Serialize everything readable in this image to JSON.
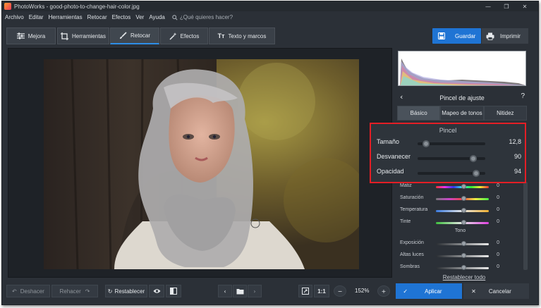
{
  "window": {
    "title": "PhotoWorks - good-photo-to-change-hair-color.jpg",
    "controls": [
      "—",
      "❐",
      "✕"
    ]
  },
  "menu": {
    "items": [
      "Archivo",
      "Editar",
      "Herramientas",
      "Retocar",
      "Efectos",
      "Ver",
      "Ayuda"
    ],
    "search_placeholder": "¿Qué quieres hacer?"
  },
  "tabs": [
    {
      "label": "Mejora",
      "icon": "sliders-icon"
    },
    {
      "label": "Herramientas",
      "icon": "crop-icon"
    },
    {
      "label": "Retocar",
      "icon": "brush-icon",
      "active": true
    },
    {
      "label": "Efectos",
      "icon": "magic-wand-icon"
    },
    {
      "label": "Texto y marcos",
      "icon": "text-icon"
    }
  ],
  "actions": {
    "save_label": "Guardar",
    "print_label": "Imprimir"
  },
  "panel": {
    "title": "Pincel de ajuste",
    "back_icon": "chevron-left-icon",
    "help_label": "?",
    "subtabs": [
      "Básico",
      "Mapeo de tonos",
      "Nitidez"
    ],
    "active_subtab": "Básico"
  },
  "brush": {
    "section_title": "Pincel",
    "sliders": [
      {
        "label": "Tamaño",
        "value": "12,8",
        "level": 0.12
      },
      {
        "label": "Desvanecer",
        "value": "90",
        "level": 0.82
      },
      {
        "label": "Opacidad",
        "value": "94",
        "level": 0.86
      }
    ]
  },
  "adjustments": {
    "color": [
      {
        "label": "Matiz",
        "value": "0"
      },
      {
        "label": "Saturación",
        "value": "0"
      },
      {
        "label": "Temperatura",
        "value": "0"
      },
      {
        "label": "Tinte",
        "value": "0"
      }
    ],
    "tone_title": "Tono",
    "tone": [
      {
        "label": "Exposición",
        "value": "0"
      },
      {
        "label": "Altas luces",
        "value": "0"
      },
      {
        "label": "Sombras",
        "value": "0"
      }
    ],
    "reset_label": "Restablecer todo"
  },
  "bottom": {
    "undo_label": "Deshacer",
    "redo_label": "Rehacer",
    "reset_label": "Restablecer",
    "zoom_ratio_label": "1:1",
    "zoom_level": "152%",
    "apply_label": "Aplicar",
    "cancel_label": "Cancelar"
  },
  "colors": {
    "accent": "#1f74d4",
    "highlight_box": "#e41e25",
    "background": "#2b3037"
  }
}
